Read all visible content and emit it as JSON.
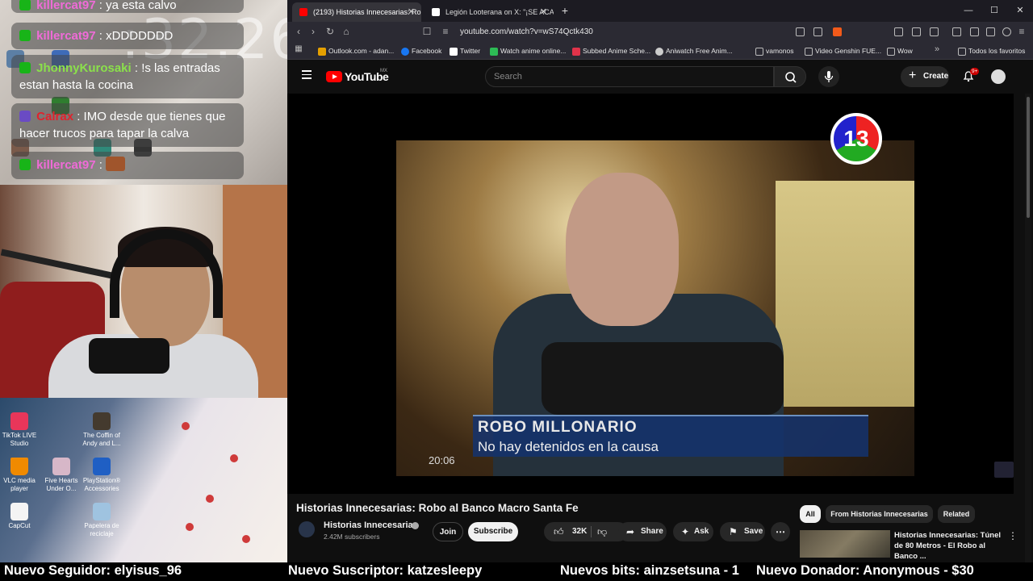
{
  "overlay": {
    "clock": ":32.26",
    "chat": [
      {
        "user": "killercat97",
        "text": " : ya esta calvo",
        "user_color": "#f06bd8"
      },
      {
        "user": "killercat97",
        "text": " : xDDDDDDD",
        "user_color": "#f06bd8"
      },
      {
        "user": "JhonnyKurosaki",
        "text": " : !s las entradas estan hasta la cocina",
        "user_color": "#8be04b"
      },
      {
        "user": "Calrax",
        "text": " : IMO desde que tienes que hacer trucos para tapar la calva",
        "user_color": "#e0232d"
      },
      {
        "user": "killercat97",
        "text": " : ",
        "user_color": "#f06bd8"
      }
    ],
    "desktop_icons": [
      {
        "label": "TikTok LIVE Studio"
      },
      {
        "label": "The Coffin of Andy and L..."
      },
      {
        "label": "VLC media player"
      },
      {
        "label": "Five Hearts Under O..."
      },
      {
        "label": "PlayStation® Accessories"
      },
      {
        "label": "CapCut"
      },
      {
        "label": "Papelera de reciclaje"
      }
    ]
  },
  "browser": {
    "tabs": [
      {
        "label": "(2193) Historias Innecesarias: Ro",
        "favicon_color": "#ff0000",
        "active": true
      },
      {
        "label": "Legión Looterana on X: \"¡SE ACA",
        "favicon_color": "#ffffff",
        "active": false
      }
    ],
    "new_tab": "+",
    "window_controls": {
      "minimize": "—",
      "maximize": "☐",
      "close": "✕"
    },
    "url": "youtube.com/watch?v=wS74Qctk430",
    "bookmarks": [
      {
        "label": "Outlook.com - adan...",
        "icon_color": "#e5a000"
      },
      {
        "label": "Facebook",
        "icon_color": "#1877f2"
      },
      {
        "label": "Twitter",
        "icon_color": "#ffffff"
      },
      {
        "label": "Watch anime online...",
        "icon_color": "#2dbb55"
      },
      {
        "label": "Subbed Anime Sche...",
        "icon_color": "#e0334a"
      },
      {
        "label": "Aniwatch Free Anim...",
        "icon_color": "#cccccc"
      },
      {
        "label": "vamonos",
        "icon_color": "#999999"
      },
      {
        "label": "Video Genshin FUE...",
        "icon_color": "#999999"
      },
      {
        "label": "Wow",
        "icon_color": "#999999"
      },
      {
        "label": "Todos los favoritos",
        "icon_color": "#999999"
      }
    ]
  },
  "youtube": {
    "logo_text": "YouTube",
    "country": "MX",
    "search_placeholder": "Search",
    "create_label": "Create",
    "notifications": "9+",
    "video": {
      "channel_bug": "13",
      "lower_third_line1": "ROBO MILLONARIO",
      "lower_third_line2": "No hay detenidos en la causa",
      "timestamp": "20:06"
    },
    "title": "Historias Innecesarias: Robo al Banco Macro Santa Fe",
    "channel": "Historias Innecesarias",
    "subscribers": "2.42M subscribers",
    "join_label": "Join",
    "subscribe_label": "Subscribe",
    "likes": "32K",
    "share_label": "Share",
    "ask_label": "Ask",
    "save_label": "Save",
    "chips": [
      "All",
      "From Historias Innecesarias",
      "Related"
    ],
    "recommendation_title": "Historias Innecesarias: Túnel de 80 Metros - El Robo al Banco ..."
  },
  "ticker": {
    "follower": "Nuevo Seguidor: elyisus_96",
    "subscriber": "Nuevo Suscriptor: katzesleepy",
    "bits": "Nuevos bits: ainzsetsuna - 1",
    "donor": "Nuevo Donador: Anonymous - $30"
  }
}
